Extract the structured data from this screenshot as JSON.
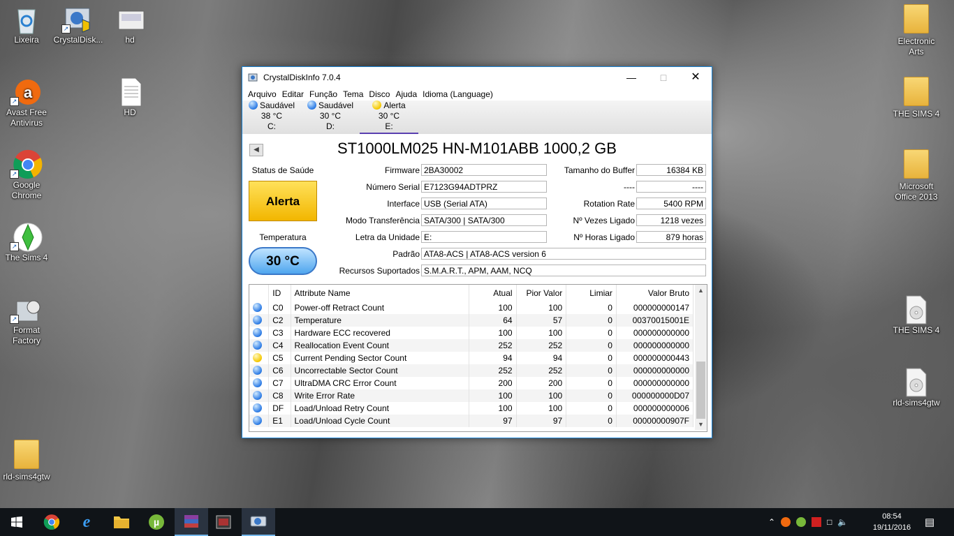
{
  "desktop_icons": [
    {
      "label": "Lixeira",
      "icon": "recycle-bin-icon"
    },
    {
      "label": "CrystalDisk...",
      "icon": "crystaldiskinfo-icon"
    },
    {
      "label": "hd",
      "icon": "file-icon"
    },
    {
      "label": "Avast Free Antivirus",
      "icon": "avast-icon"
    },
    {
      "label": "HD",
      "icon": "document-icon"
    },
    {
      "label": "Google Chrome",
      "icon": "chrome-icon"
    },
    {
      "label": "The Sims 4",
      "icon": "sims-icon"
    },
    {
      "label": "Format Factory",
      "icon": "format-factory-icon"
    },
    {
      "label": "rld-sims4gtw",
      "icon": "folder-icon"
    },
    {
      "label": "Electronic Arts",
      "icon": "folder-icon"
    },
    {
      "label": "THE SIMS 4",
      "icon": "folder-icon"
    },
    {
      "label": "Microsoft Office 2013",
      "icon": "folder-icon"
    },
    {
      "label": "THE SIMS 4",
      "icon": "disc-image-icon"
    },
    {
      "label": "rld-sims4gtw",
      "icon": "disc-image-icon"
    }
  ],
  "window": {
    "title": "CrystalDiskInfo 7.0.4",
    "menu": [
      "Arquivo",
      "Editar",
      "Função",
      "Tema",
      "Disco",
      "Ajuda",
      "Idioma (Language)"
    ],
    "disk_tabs": [
      {
        "status": "Saudável",
        "temp": "38 °C",
        "drive": "C:",
        "color": "#2c7be5"
      },
      {
        "status": "Saudável",
        "temp": "30 °C",
        "drive": "D:",
        "color": "#2c7be5"
      },
      {
        "status": "Alerta",
        "temp": "30 °C",
        "drive": "E:",
        "color": "#f5c800"
      }
    ],
    "model": "ST1000LM025 HN-M101ABB 1000,2 GB",
    "health_label": "Status de Saúde",
    "health_value": "Alerta",
    "temp_label": "Temperatura",
    "temp_value": "30 °C",
    "info": {
      "firmware_label": "Firmware",
      "firmware": "2BA30002",
      "serial_label": "Número Serial",
      "serial": "E7123G94ADTPRZ",
      "interface_label": "Interface",
      "interface": "USB (Serial ATA)",
      "transfer_label": "Modo Transferência",
      "transfer": "SATA/300 | SATA/300",
      "drive_letter_label": "Letra da Unidade",
      "drive_letter": "E:",
      "standard_label": "Padrão",
      "standard": "ATA8-ACS | ATA8-ACS version 6",
      "features_label": "Recursos Suportados",
      "features": "S.M.A.R.T., APM, AAM, NCQ",
      "buffer_label": "Tamanho do Buffer",
      "buffer": "16384 KB",
      "blank_label": "----",
      "blank": "----",
      "rotation_label": "Rotation Rate",
      "rotation": "5400 RPM",
      "power_on_count_label": "Nº Vezes Ligado",
      "power_on_count": "1218 vezes",
      "power_on_hours_label": "Nº Horas Ligado",
      "power_on_hours": "879 horas"
    },
    "smart_headers": [
      "ID",
      "Attribute Name",
      "Atual",
      "Pior Valor",
      "Limiar",
      "Valor Bruto"
    ],
    "smart_rows": [
      {
        "status": "blue",
        "id": "C0",
        "name": "Power-off Retract Count",
        "current": "100",
        "worst": "100",
        "threshold": "0",
        "raw": "000000000147"
      },
      {
        "status": "blue",
        "id": "C2",
        "name": "Temperature",
        "current": "64",
        "worst": "57",
        "threshold": "0",
        "raw": "00370015001E"
      },
      {
        "status": "blue",
        "id": "C3",
        "name": "Hardware ECC recovered",
        "current": "100",
        "worst": "100",
        "threshold": "0",
        "raw": "000000000000"
      },
      {
        "status": "blue",
        "id": "C4",
        "name": "Reallocation Event Count",
        "current": "252",
        "worst": "252",
        "threshold": "0",
        "raw": "000000000000"
      },
      {
        "status": "yellow",
        "id": "C5",
        "name": "Current Pending Sector Count",
        "current": "94",
        "worst": "94",
        "threshold": "0",
        "raw": "000000000443"
      },
      {
        "status": "blue",
        "id": "C6",
        "name": "Uncorrectable Sector Count",
        "current": "252",
        "worst": "252",
        "threshold": "0",
        "raw": "000000000000"
      },
      {
        "status": "blue",
        "id": "C7",
        "name": "UltraDMA CRC Error Count",
        "current": "200",
        "worst": "200",
        "threshold": "0",
        "raw": "000000000000"
      },
      {
        "status": "blue",
        "id": "C8",
        "name": "Write Error Rate",
        "current": "100",
        "worst": "100",
        "threshold": "0",
        "raw": "000000000D07"
      },
      {
        "status": "blue",
        "id": "DF",
        "name": "Load/Unload Retry Count",
        "current": "100",
        "worst": "100",
        "threshold": "0",
        "raw": "000000000006"
      },
      {
        "status": "blue",
        "id": "E1",
        "name": "Load/Unload Cycle Count",
        "current": "97",
        "worst": "97",
        "threshold": "0",
        "raw": "00000000907F"
      }
    ]
  },
  "taskbar": {
    "apps": [
      "windows-start-icon",
      "chrome-icon",
      "edge-icon",
      "file-explorer-icon",
      "utorrent-icon",
      "winrar-icon",
      "media-icon",
      "crystaldiskinfo-icon"
    ],
    "time": "08:54",
    "date": "19/11/2016"
  }
}
